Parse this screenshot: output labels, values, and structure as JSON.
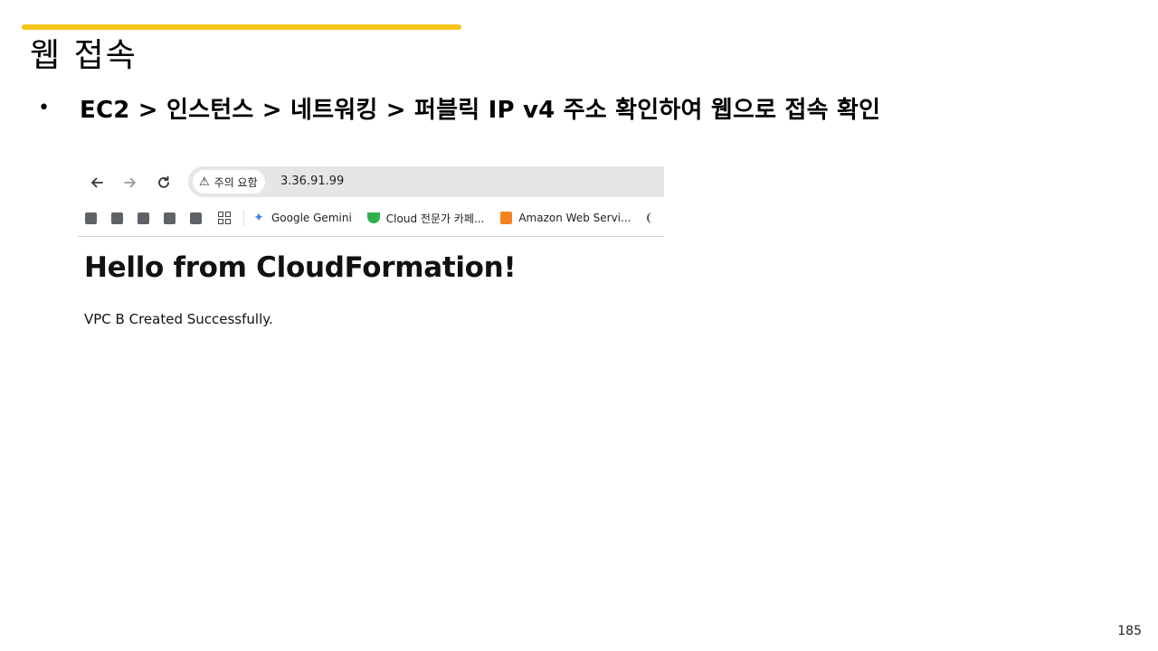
{
  "slide": {
    "title": "웹 접속",
    "bullet": "EC2 > 인스턴스 > 네트워킹 > 퍼블릭 IP v4 주소 확인하여 웹으로 접속 확인",
    "page_number": "185",
    "accent_color": "#f5c518"
  },
  "browser": {
    "nav": {
      "back_icon": "arrow-left-icon",
      "forward_icon": "arrow-right-icon",
      "reload_icon": "reload-icon"
    },
    "address_bar": {
      "security_label": "주의 요함",
      "url": "3.36.91.99"
    },
    "bookmarks": [
      {
        "label": "Google Gemini",
        "icon": "gemini-icon"
      },
      {
        "label": "Cloud 전문가 카페...",
        "icon": "cafe-icon"
      },
      {
        "label": "Amazon Web Servi...",
        "icon": "aws-icon"
      }
    ],
    "page": {
      "heading": "Hello from CloudFormation!",
      "body": "VPC B Created Successfully."
    }
  }
}
